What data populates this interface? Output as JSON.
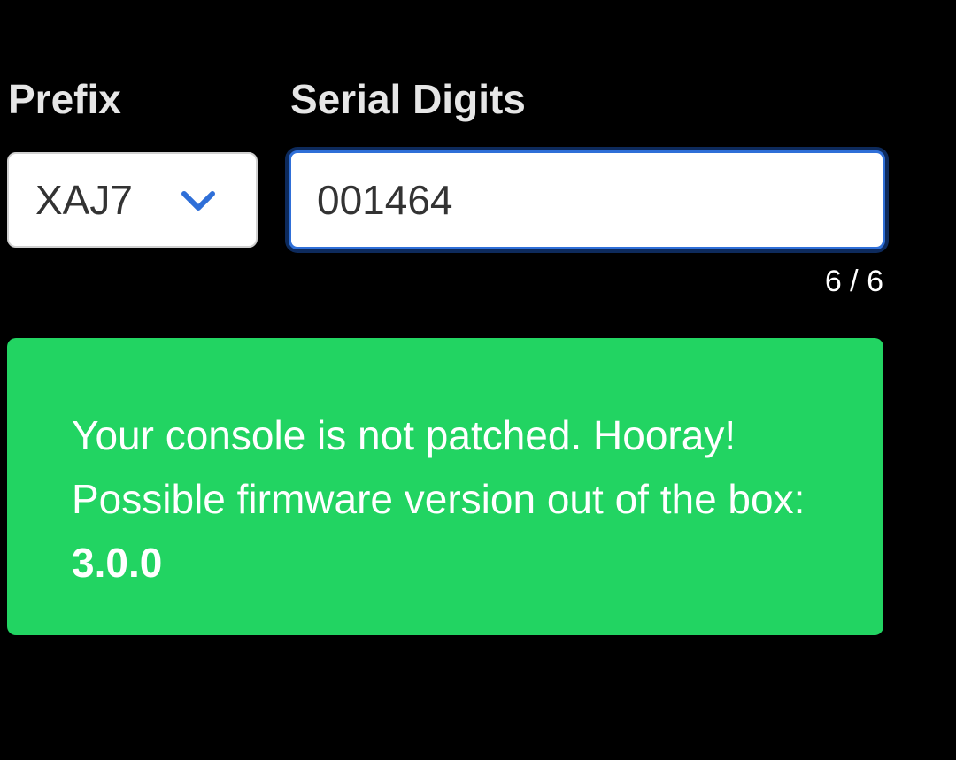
{
  "form": {
    "prefix_label": "Prefix",
    "serial_label": "Serial Digits",
    "prefix_value": "XAJ7",
    "serial_value": "001464",
    "counter": "6 / 6"
  },
  "result": {
    "message": "Your console is not patched. Hooray! Possible firmware version out of the box: ",
    "version": "3.0.0"
  },
  "colors": {
    "background": "#000000",
    "success": "#22d462",
    "focus_border": "#2f6fd8",
    "chevron": "#2f6fd8"
  },
  "icons": {
    "prefix_dropdown": "chevron-down-icon"
  }
}
